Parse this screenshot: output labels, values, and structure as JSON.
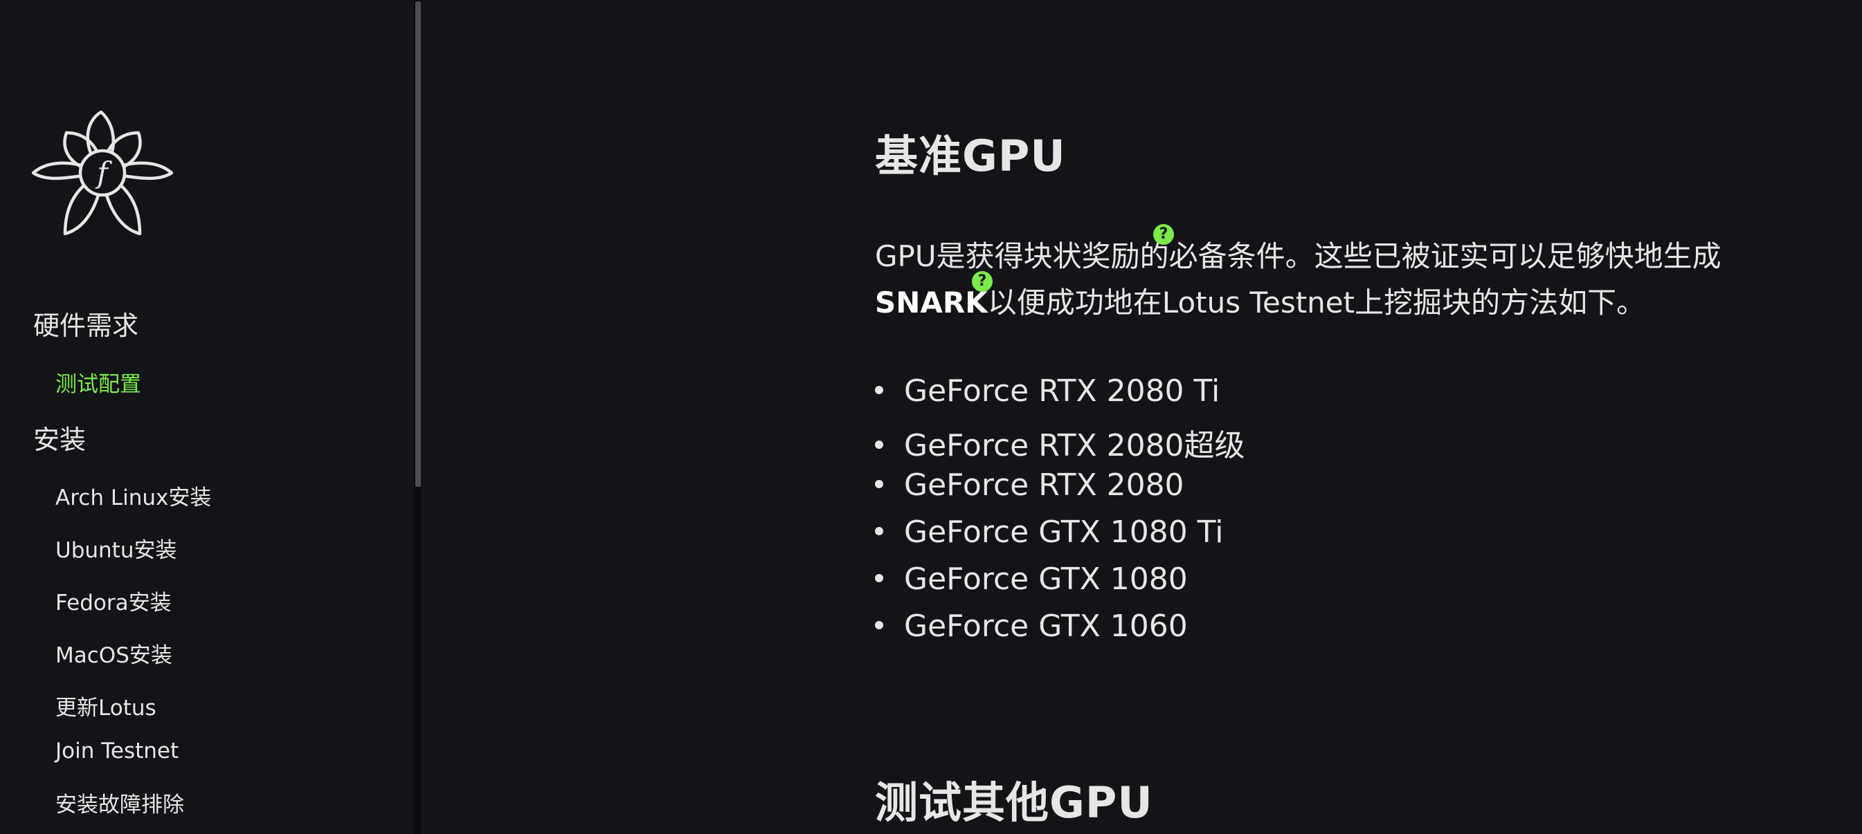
{
  "sidebar": {
    "logo_icon": "filecoin-flower-logo",
    "sections": [
      {
        "label": "硬件需求",
        "items": [
          {
            "label": "测试配置",
            "active": true
          }
        ]
      },
      {
        "label": "安装",
        "items": [
          {
            "label": "Arch Linux安装"
          },
          {
            "label": "Ubuntu安装"
          },
          {
            "label": "Fedora安装"
          },
          {
            "label": "MacOS安装"
          },
          {
            "label": "更新Lotus"
          },
          {
            "label": "Join Testnet"
          },
          {
            "label": "安装故障排除"
          }
        ]
      }
    ]
  },
  "main": {
    "heading1": "基准GPU",
    "para_line1_a": "GPU是获得块状奖励",
    "para_line1_b": "的必备条件。这些已被证实可以足够快地生成",
    "para_line2_bold": "SNARK",
    "para_line2_rest": "以便成功地在Lotus Testnet上挖掘块的方法如下。",
    "hint_icon_label": "?",
    "gpu_list": [
      "GeForce RTX 2080 Ti",
      "GeForce RTX 2080超级",
      "GeForce RTX 2080",
      "GeForce GTX 1080 Ti",
      "GeForce GTX 1080",
      "GeForce GTX 1060"
    ],
    "heading2": "测试其他GPU"
  },
  "colors": {
    "background": "#121417",
    "accent": "#7bea4a",
    "text": "#e6e6e6"
  }
}
